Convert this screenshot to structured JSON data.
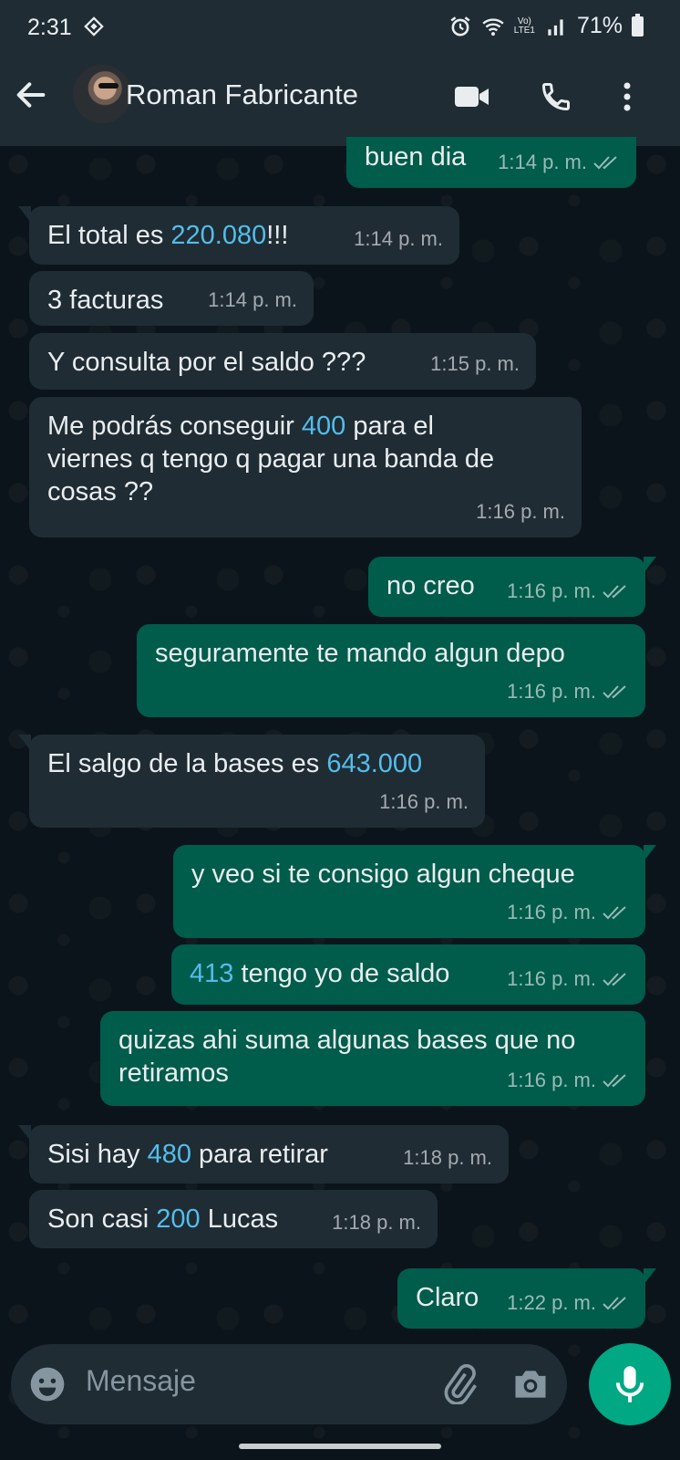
{
  "status_bar": {
    "time": "2:31",
    "network": "Vo)\nLTE1",
    "battery": "71%"
  },
  "header": {
    "contact_name": "Roman Fabricante"
  },
  "messages": [
    {
      "dir": "out",
      "parts": [
        {
          "t": "buen dia"
        }
      ],
      "time": "1:14 p. m."
    },
    {
      "dir": "in",
      "parts": [
        {
          "t": "El total es "
        },
        {
          "t": "220.080",
          "n": true
        },
        {
          "t": "!!!"
        }
      ],
      "time": "1:14 p. m."
    },
    {
      "dir": "in",
      "parts": [
        {
          "t": "3 facturas"
        }
      ],
      "time": "1:14 p. m."
    },
    {
      "dir": "in",
      "parts": [
        {
          "t": "Y consulta por el saldo ???"
        }
      ],
      "time": "1:15 p. m."
    },
    {
      "dir": "in",
      "parts": [
        {
          "t": "Me podrás conseguir "
        },
        {
          "t": "400",
          "n": true
        },
        {
          "t": " para el\nviernes q tengo q pagar una banda de\ncosas ??"
        }
      ],
      "time": "1:16 p. m."
    },
    {
      "dir": "out",
      "parts": [
        {
          "t": "no creo"
        }
      ],
      "time": "1:16 p. m."
    },
    {
      "dir": "out",
      "parts": [
        {
          "t": "seguramente te mando algun depo"
        }
      ],
      "time": "1:16 p. m."
    },
    {
      "dir": "in",
      "parts": [
        {
          "t": "El salgo de la bases es "
        },
        {
          "t": "643.000",
          "n": true
        }
      ],
      "time": "1:16 p. m."
    },
    {
      "dir": "out",
      "parts": [
        {
          "t": "y veo si te consigo algun cheque"
        }
      ],
      "time": "1:16 p. m."
    },
    {
      "dir": "out",
      "parts": [
        {
          "t": "413",
          "n": true
        },
        {
          "t": " tengo yo de saldo"
        }
      ],
      "time": "1:16 p. m."
    },
    {
      "dir": "out",
      "parts": [
        {
          "t": "quizas ahi suma algunas bases que no\nretiramos"
        }
      ],
      "time": "1:16 p. m."
    },
    {
      "dir": "in",
      "parts": [
        {
          "t": "Sisi hay "
        },
        {
          "t": "480",
          "n": true
        },
        {
          "t": " para retirar"
        }
      ],
      "time": "1:18 p. m."
    },
    {
      "dir": "in",
      "parts": [
        {
          "t": "Son casi "
        },
        {
          "t": "200",
          "n": true
        },
        {
          "t": " Lucas"
        }
      ],
      "time": "1:18 p. m."
    },
    {
      "dir": "out",
      "parts": [
        {
          "t": "Claro"
        }
      ],
      "time": "1:22 p. m."
    }
  ],
  "composer": {
    "placeholder": "Mensaje"
  },
  "colors": {
    "incoming": "#1f2c34",
    "outgoing": "#005c4b",
    "link_number": "#53bdeb",
    "mic_button": "#00a884"
  },
  "icons": [
    "back-arrow-icon",
    "video-call-icon",
    "phone-icon",
    "more-vert-icon",
    "emoji-icon",
    "attach-icon",
    "camera-icon",
    "mic-icon",
    "double-check-icon"
  ]
}
